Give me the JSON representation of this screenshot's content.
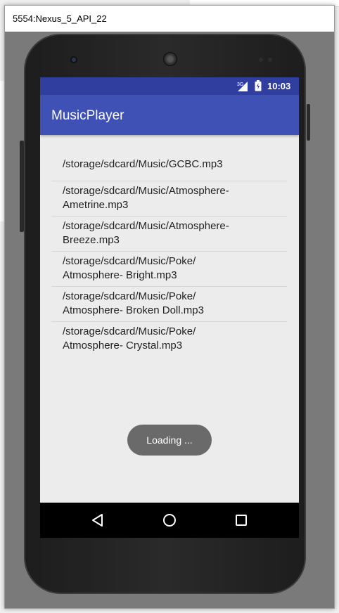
{
  "window": {
    "title": "5554:Nexus_5_API_22"
  },
  "status_bar": {
    "time": "10:03",
    "network": "3G"
  },
  "app_bar": {
    "title": "MusicPlayer"
  },
  "songs": [
    {
      "line1": "/storage/sdcard/Music/GCBC.mp3",
      "line2": ""
    },
    {
      "line1": "/storage/sdcard/Music/Atmosphere-",
      "line2": "Ametrine.mp3"
    },
    {
      "line1": "/storage/sdcard/Music/Atmosphere-",
      "line2": "Breeze.mp3"
    },
    {
      "line1": "/storage/sdcard/Music/Poke/",
      "line2": "Atmosphere- Bright.mp3"
    },
    {
      "line1": "/storage/sdcard/Music/Poke/",
      "line2": "Atmosphere- Broken Doll.mp3"
    },
    {
      "line1": "/storage/sdcard/Music/Poke/",
      "line2": "Atmosphere- Crystal.mp3"
    }
  ],
  "toast": {
    "text": "Loading ..."
  },
  "nav": {
    "back": "back-icon",
    "home": "home-icon",
    "recents": "recents-icon"
  },
  "colors": {
    "status_bar": "#303f9f",
    "app_bar": "#3f51b5",
    "screen_bg": "#ececec",
    "toast_bg": "#6a6a6a"
  }
}
